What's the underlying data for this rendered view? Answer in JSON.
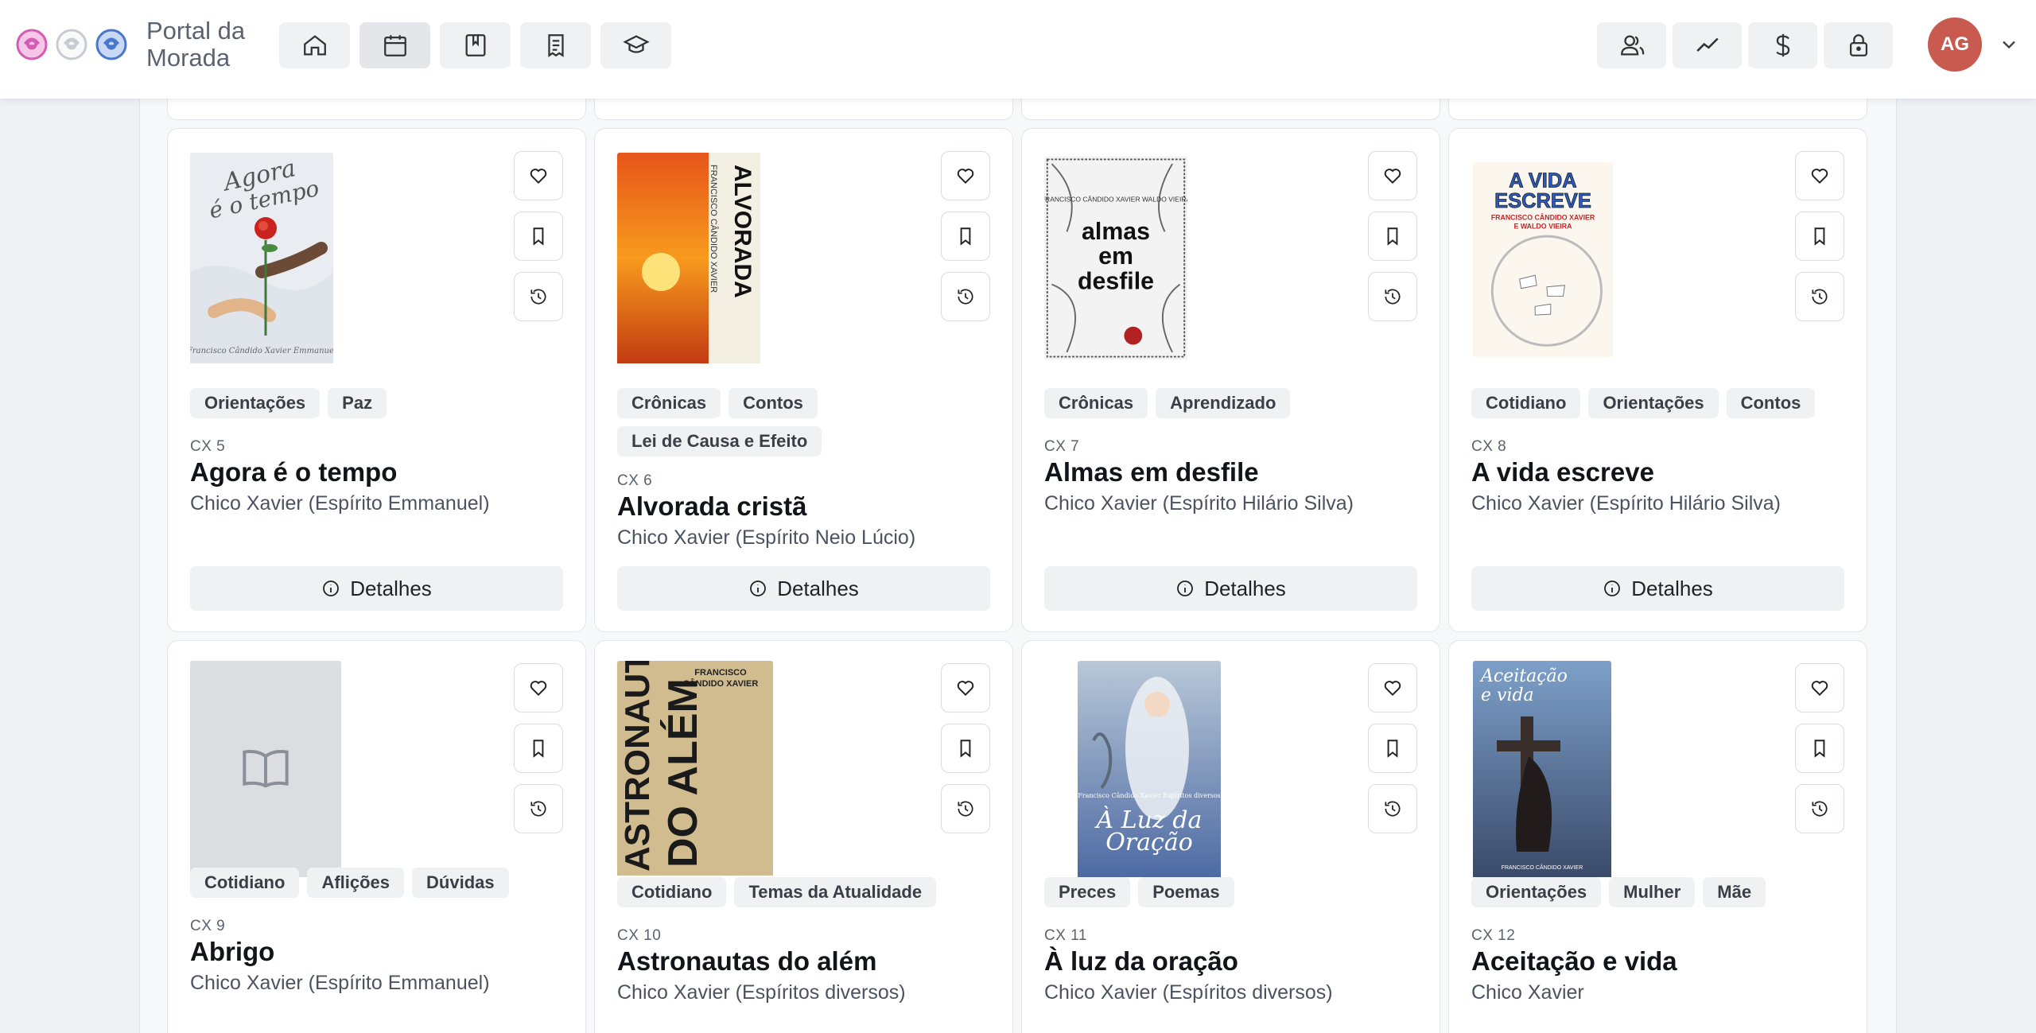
{
  "header": {
    "brand": "Portal da Morada",
    "avatar_initials": "AG",
    "avatar_color": "#c95a4f",
    "nav_icons": [
      "home-icon",
      "calendar-icon",
      "book-bookmark-icon",
      "receipt-icon",
      "graduation-cap-icon"
    ],
    "right_icons": [
      "users-icon",
      "trend-line-icon",
      "dollar-icon",
      "lock-icon"
    ]
  },
  "card_ui": {
    "details_label": "Detalhes",
    "action_icons": [
      "heart-icon",
      "bookmark-icon",
      "history-icon"
    ]
  },
  "books": [
    {
      "code": "CX 5",
      "title": "Agora é o tempo",
      "author": "Chico Xavier (Espírito Emmanuel)",
      "tags": [
        "Orientações",
        "Paz"
      ],
      "cover": {
        "text_top": "Agora é o tempo",
        "text_bottom": "Francisco Cândido Xavier Emmanuel"
      }
    },
    {
      "code": "CX 6",
      "title": "Alvorada cristã",
      "author": "Chico Xavier (Espírito Neio Lúcio)",
      "tags": [
        "Crônicas",
        "Contos",
        "Lei de Causa e Efeito"
      ],
      "cover": {
        "text_top": "ALVORADA CRISTÃ",
        "text_bottom": "FRANCISCO CÂNDIDO XAVIER"
      }
    },
    {
      "code": "CX 7",
      "title": "Almas em desfile",
      "author": "Chico Xavier (Espírito Hilário Silva)",
      "tags": [
        "Crônicas",
        "Aprendizado"
      ],
      "cover": {
        "text_top": "almas em desfile",
        "text_bottom": "FRANCISCO CÂNDIDO XAVIER WALDO VIEIRA"
      }
    },
    {
      "code": "CX 8",
      "title": "A vida escreve",
      "author": "Chico Xavier (Espírito Hilário Silva)",
      "tags": [
        "Cotidiano",
        "Orientações",
        "Contos"
      ],
      "cover": {
        "text_top": "A VIDA ESCREVE",
        "text_bottom": "FRANCISCO CÂNDIDO XAVIER E WALDO VIEIRA"
      }
    },
    {
      "code": "CX 9",
      "title": "Abrigo",
      "author": "Chico Xavier (Espírito Emmanuel)",
      "tags": [
        "Cotidiano",
        "Aflições",
        "Dúvidas"
      ],
      "cover": {
        "text_top": "",
        "text_bottom": ""
      }
    },
    {
      "code": "CX 10",
      "title": "Astronautas do além",
      "author": "Chico Xavier (Espíritos diversos)",
      "tags": [
        "Cotidiano",
        "Temas da Atualidade"
      ],
      "cover": {
        "text_top": "ASTRONAUTAS DO ALÉM",
        "text_bottom": "FRANCISCO CÂNDIDO XAVIER"
      }
    },
    {
      "code": "CX 11",
      "title": "À luz da oração",
      "author": "Chico Xavier (Espíritos diversos)",
      "tags": [
        "Preces",
        "Poemas"
      ],
      "cover": {
        "text_top": "À Luz da Oração",
        "text_bottom": "Francisco Cândido Xavier Espíritos diversos"
      }
    },
    {
      "code": "CX 12",
      "title": "Aceitação e vida",
      "author": "Chico Xavier",
      "tags": [
        "Orientações",
        "Mulher",
        "Mãe"
      ],
      "cover": {
        "text_top": "Aceitação e vida",
        "text_bottom": "FRANCISCO CÂNDIDO XAVIER"
      }
    }
  ]
}
